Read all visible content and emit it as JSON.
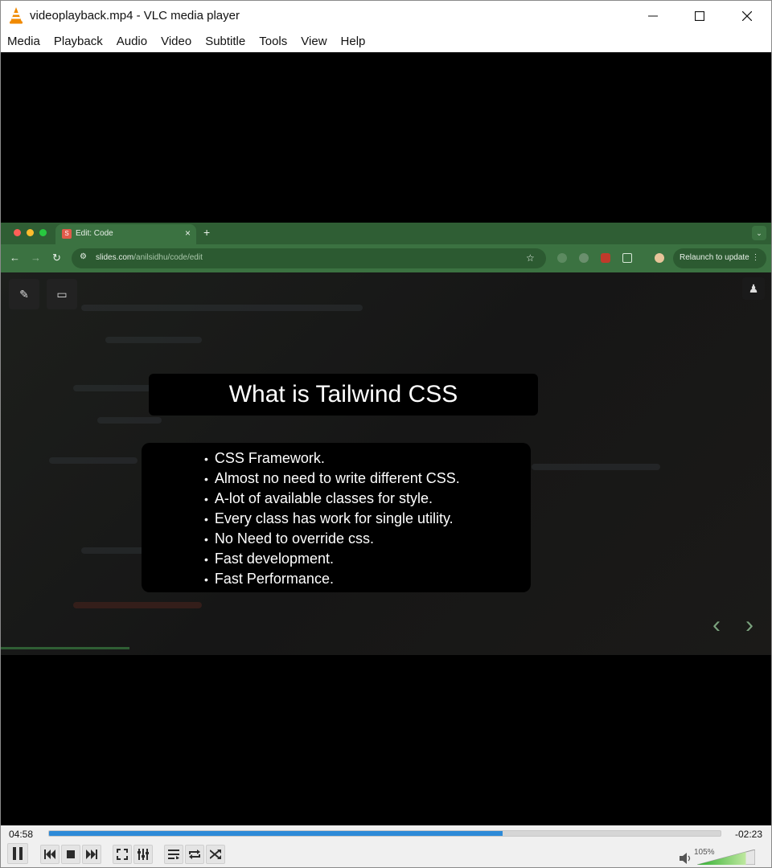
{
  "window": {
    "title": "videoplayback.mp4 - VLC media player"
  },
  "menu": [
    "Media",
    "Playback",
    "Audio",
    "Video",
    "Subtitle",
    "Tools",
    "View",
    "Help"
  ],
  "browser": {
    "tab_favicon": "S",
    "tab_title": "Edit: Code",
    "url_host": "slides.com",
    "url_path": "/anilsidhu/code/edit",
    "relaunch_label": "Relaunch to update"
  },
  "slide": {
    "title": "What is Tailwind CSS",
    "bullets": [
      "CSS Framework.",
      "Almost no need to write different CSS.",
      "A-lot of available classes for style.",
      "Every class has work for single utility.",
      "No Need to override css.",
      "Fast development.",
      "Fast Performance."
    ]
  },
  "player": {
    "elapsed": "04:58",
    "remaining": "-02:23",
    "progress": 0.676,
    "volume_label": "105%",
    "volume_level": 1.05
  },
  "colors": {
    "seek_fill": "#2d8ad8",
    "browser_green": "#3b7241",
    "volume_green": "#2fae2f"
  }
}
